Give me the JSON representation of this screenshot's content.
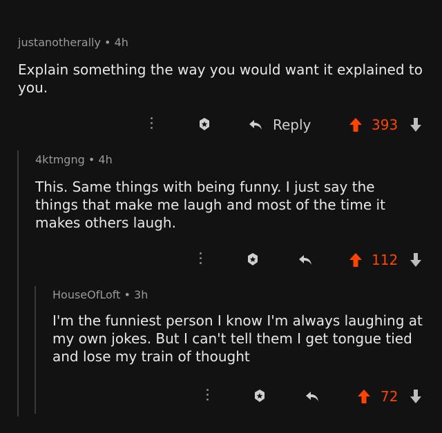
{
  "colors": {
    "background": "#121212",
    "upvote": "#ff4500",
    "text": "#e8e8e8",
    "meta": "#9a9a9a"
  },
  "comments": [
    {
      "author": "justanotherally",
      "time": "4h",
      "body": "Explain something the way you would want it explained to you.",
      "reply_label": "Reply",
      "score": "393",
      "icons": [
        "more-dots-icon",
        "award-icon",
        "reply-arrow-icon",
        "upvote-arrow-icon",
        "downvote-arrow-icon"
      ]
    },
    {
      "author": "4ktmgng",
      "time": "4h",
      "body": "This. Same things with being funny. I just say the things that make me laugh and most of the time it makes others laugh.",
      "score": "112"
    },
    {
      "author": "HouseOfLoft",
      "time": "3h",
      "body": "I'm the funniest person I know I'm always laughing at my own jokes. But I can't tell them I get tongue tied and lose my train of thought",
      "score": "72"
    }
  ]
}
